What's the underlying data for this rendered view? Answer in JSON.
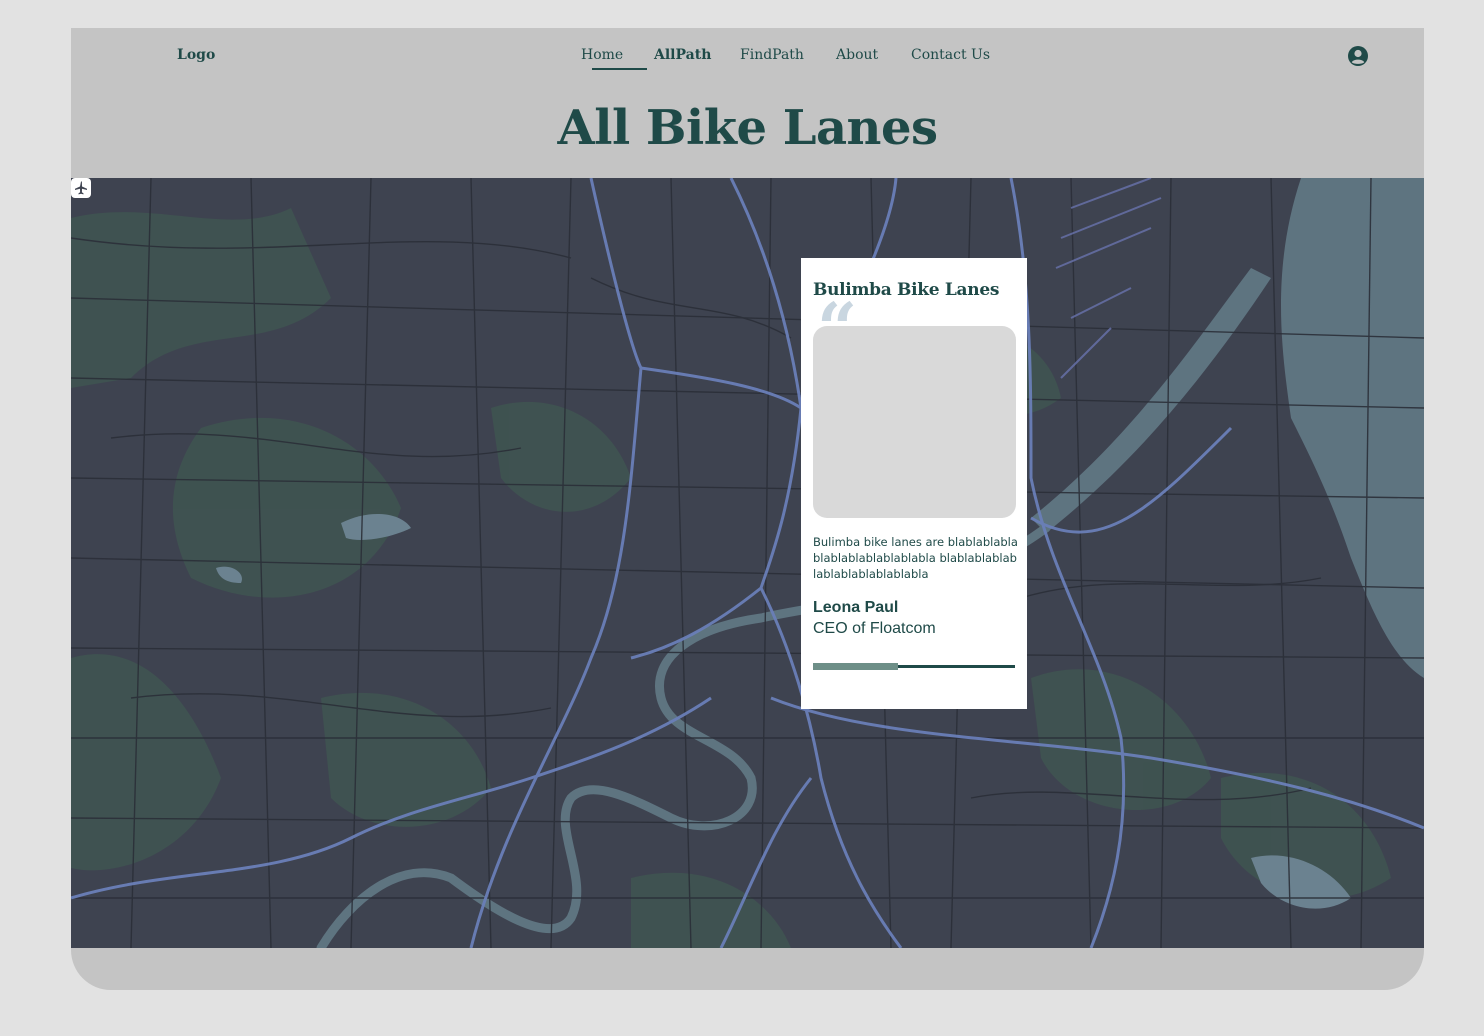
{
  "nav": {
    "logo": "Logo",
    "links": [
      {
        "label": "Home",
        "active": false
      },
      {
        "label": "AllPath",
        "active": true
      },
      {
        "label": "FindPath",
        "active": false
      },
      {
        "label": "About",
        "active": false
      },
      {
        "label": "Contact Us",
        "active": false
      }
    ],
    "user_icon": "user-circle-icon"
  },
  "page": {
    "title": "All Bike Lanes"
  },
  "map": {
    "marker_icon": "airport-icon"
  },
  "card": {
    "title": "Bulimba Bike Lanes",
    "quote_icon": "quote-icon",
    "text": "Bulimba bike lanes are blablablablablablablablablablabla blablablablablablablablablablabla",
    "author": "Leona Paul",
    "role": "CEO of Floatcom",
    "progress": 0.42
  },
  "colors": {
    "primary": "#1f4a48",
    "header_bg": "#c4c4c4",
    "map_bg": "#3e4350",
    "water": "#5e7480",
    "roads": "#6a7fb8",
    "parks": "#3f5551"
  }
}
